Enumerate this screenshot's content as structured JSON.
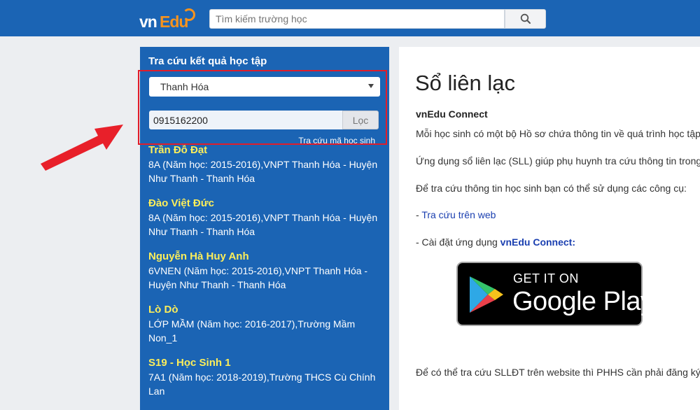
{
  "header": {
    "logo_vn": "vn",
    "logo_edu": "Edu",
    "search_placeholder": "Tìm kiếm trường học"
  },
  "sidebar": {
    "title": "Tra cứu kết quả học tập",
    "province_selected": "Thanh Hóa",
    "phone_value": "0915162200",
    "filter_button": "Lọc",
    "lookup_code_link": "Tra cứu mã học sinh",
    "students": [
      {
        "name": "Trần Đỗ Đạt",
        "info": "8A (Năm học: 2015-2016),VNPT Thanh Hóa - Huyện Như Thanh - Thanh Hóa"
      },
      {
        "name": "Đào Việt Đức",
        "info": "8A (Năm học: 2015-2016),VNPT Thanh Hóa - Huyện Như Thanh - Thanh Hóa"
      },
      {
        "name": "Nguyễn Hà Huy Anh",
        "info": "6VNEN (Năm học: 2015-2016),VNPT Thanh Hóa - Huyện Như Thanh - Thanh Hóa"
      },
      {
        "name": "Lò Dò",
        "info": "LỚP MẦM (Năm học: 2016-2017),Trường Mầm Non_1"
      },
      {
        "name": "S19 - Học Sinh 1",
        "info": "7A1 (Năm học: 2018-2019),Trường THCS Cù Chính Lan"
      }
    ]
  },
  "main": {
    "title": "Sổ liên lạc",
    "subtitle": "vnEdu Connect",
    "p1": "Mỗi học sinh có một bộ Hồ sơ chứa thông tin về quá trình học tập",
    "p2": "Ứng dụng sổ liên lạc (SLL) giúp phụ huynh tra cứu thông tin trong",
    "p3": "Để tra cứu thông tin học sinh bạn có thể sử dụng các công cụ:",
    "tool1_prefix": "- ",
    "tool1_link": "Tra cứu trên web",
    "tool2_prefix": "- Cài đặt ứng dụng ",
    "tool2_link": "vnEdu Connect:",
    "store_get": "GET IT ON",
    "store_name": "Google Play",
    "p4": "Để có thể tra cứu SLLĐT trên website thì PHHS cần phải đăng ký"
  },
  "colors": {
    "brand_blue": "#1b64b4",
    "student_name": "#fcee5a",
    "highlight_red": "#e11d2a",
    "arrow_red": "#e8202a"
  }
}
